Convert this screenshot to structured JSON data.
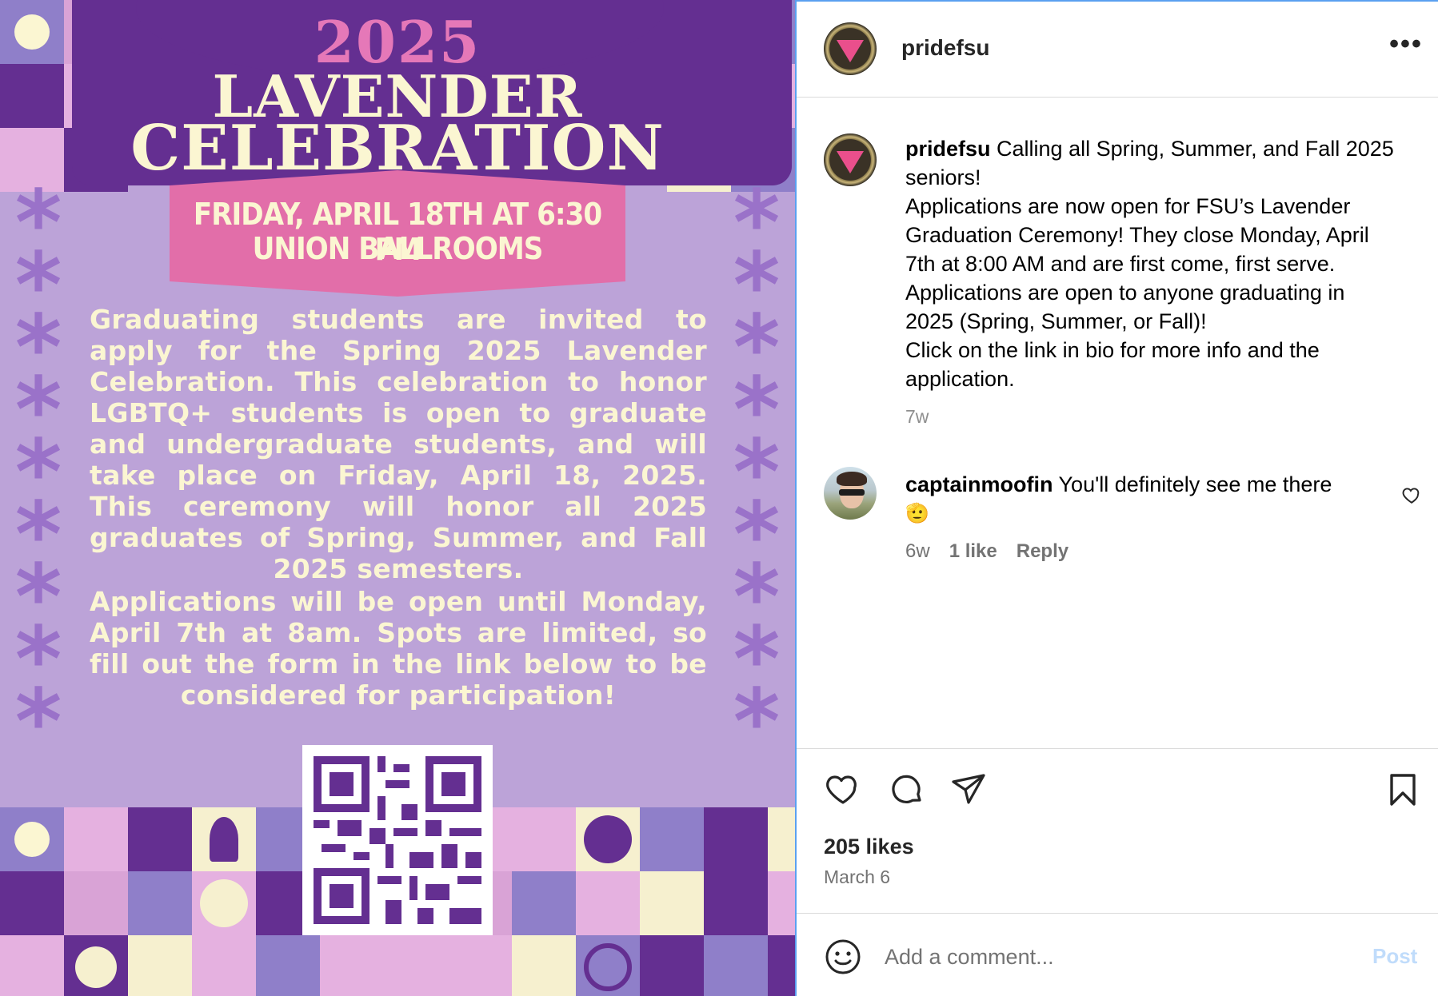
{
  "poster": {
    "year": "2025",
    "title_line_1": "LAVENDER",
    "title_line_2": "CELEBRATION",
    "banner_line_1": "FRIDAY, APRIL 18TH AT 6:30 PM",
    "banner_line_2": "UNION BALLROOMS",
    "paragraph_1": "Graduating students are invited to apply for the Spring 2025 Lavender Celebration. This celebration to honor LGBTQ+ students is open to graduate and undergraduate students, and will take place on Friday, April 18, 2025. This ceremony will honor all 2025 graduates of Spring, Summer, and Fall 2025 semesters.",
    "paragraph_2": "Applications will be open until Monday, April 7th at 8am. Spots are limited, so fill out the form in the link below to be considered for participation!",
    "qr_icon": "qr-code-icon"
  },
  "post": {
    "header_username": "pridefsu",
    "more_icon": "more-options-icon",
    "caption_username": "pridefsu",
    "caption_lines": [
      "Calling all Spring, Summer, and Fall 2025",
      "seniors!",
      "Applications are now open for FSU’s Lavender",
      "Graduation Ceremony! They close Monday, April",
      "7th at 8:00 AM and are first come, first serve.",
      "Applications are open to anyone graduating in",
      "2025 (Spring, Summer, or Fall)!",
      "Click on the link in bio for more info and the",
      "application."
    ],
    "caption_time": "7w",
    "comment": {
      "username": "captainmoofin",
      "text": "You'll definitely see me there",
      "emoji": "🫡",
      "time": "6w",
      "likes": "1 like",
      "reply_label": "Reply"
    },
    "likes": "205 likes",
    "date": "March 6",
    "comment_placeholder": "Add a comment...",
    "post_button": "Post"
  },
  "colors": {
    "poster_background": "#bca3d8",
    "poster_purple": "#642f91",
    "poster_pink": "#e26ea9",
    "poster_cream": "#fbf6d2",
    "link_blue_disabled": "#c0dcfb"
  }
}
